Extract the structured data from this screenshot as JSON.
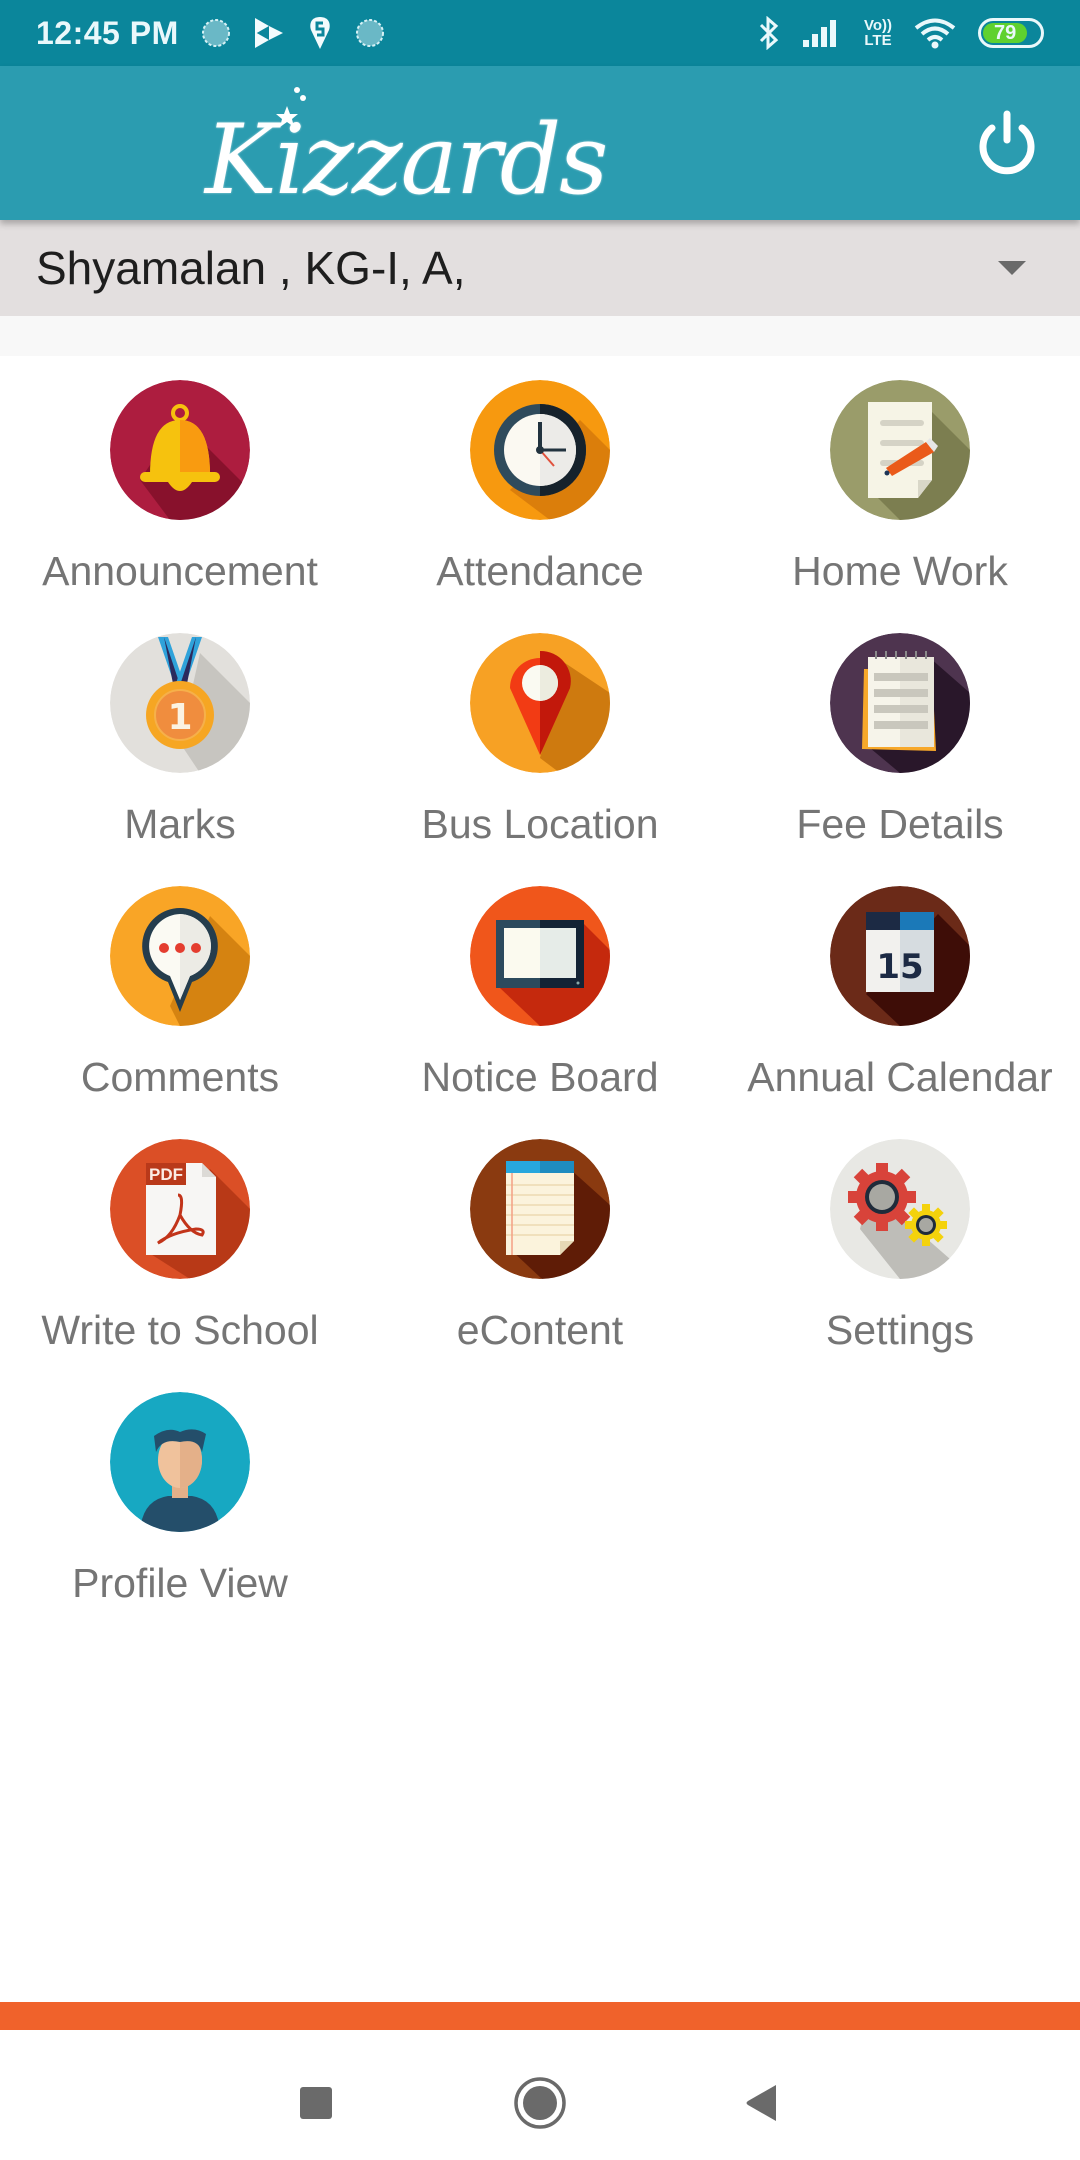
{
  "status_bar": {
    "time": "12:45 PM",
    "left_icons": [
      "sync-icon",
      "play-store-icon",
      "swiggy-icon",
      "sync-icon"
    ],
    "right_icons": [
      "bluetooth-icon",
      "signal-icon",
      "volte-icon",
      "wifi-icon",
      "battery-icon"
    ],
    "volte_top": "Vo))",
    "volte_bottom": "LTE",
    "battery_level": "79",
    "battery_percent": 79,
    "bar_color": "#0b869b"
  },
  "app_bar": {
    "logo_text": "Kizzards",
    "logout_icon": "power-icon",
    "color": "#2b9cb0"
  },
  "student_selector": {
    "value": "Shyamalan , KG-I, A,",
    "dropdown_icon": "dropdown-arrow-icon"
  },
  "menu": {
    "items": [
      {
        "label": "Announcement",
        "icon": "bell-icon",
        "bg": "#ad1d3f"
      },
      {
        "label": "Attendance",
        "icon": "clock-icon",
        "bg": "#f7990f"
      },
      {
        "label": "Home Work",
        "icon": "homework-icon",
        "bg": "#9a9c6a"
      },
      {
        "label": "Marks",
        "icon": "medal-icon",
        "bg": "#e2e0dc"
      },
      {
        "label": "Bus Location",
        "icon": "location-pin-icon",
        "bg": "#f7a124"
      },
      {
        "label": "Fee Details",
        "icon": "notepad-icon",
        "bg": "#4e344f"
      },
      {
        "label": "Comments",
        "icon": "chat-bubble-icon",
        "bg": "#f9a526"
      },
      {
        "label": "Notice Board",
        "icon": "board-icon",
        "bg": "#f0561b"
      },
      {
        "label": "Annual Calendar",
        "icon": "calendar-icon",
        "bg": "#6b2a18",
        "calendar_day": "15"
      },
      {
        "label": "Write to School",
        "icon": "pdf-icon",
        "bg": "#db4f26",
        "pdf_text": "PDF"
      },
      {
        "label": "eContent",
        "icon": "notes-icon",
        "bg": "#8a3a10"
      },
      {
        "label": "Settings",
        "icon": "gears-icon",
        "bg": "#e8e8e4"
      },
      {
        "label": "Profile View",
        "icon": "profile-avatar-icon",
        "bg": "#17a8c2"
      }
    ]
  },
  "bottom_strip_color": "#f0622b",
  "nav_bar": {
    "buttons": [
      "recents-button",
      "home-button",
      "back-button"
    ]
  }
}
